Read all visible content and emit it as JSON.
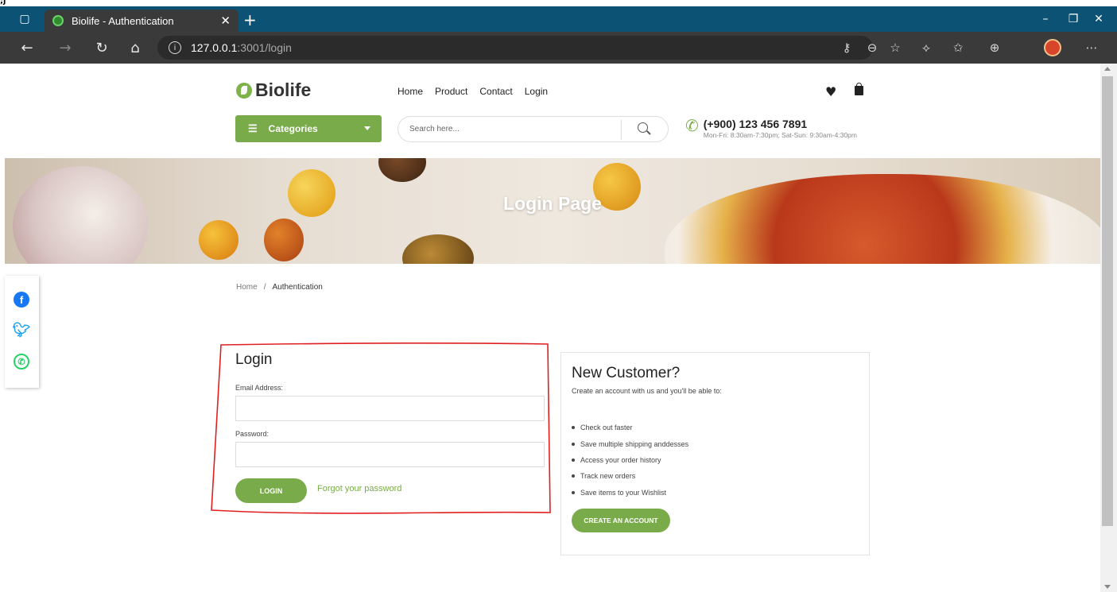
{
  "browser": {
    "tab_title": "Biolife - Authentication",
    "url_host": "127.0.0.1",
    "url_path": ":3001/login"
  },
  "site": {
    "logo": "Biolife",
    "nav": [
      "Home",
      "Product",
      "Contact",
      "Login"
    ],
    "categories_label": "Categories",
    "search_placeholder": "Search here...",
    "phone": "(+900) 123 456 7891",
    "hours": "Mon-Fri: 8:30am-7:30pm; Sat-Sun: 9:30am-4:30pm"
  },
  "banner": {
    "title": "Login Page"
  },
  "breadcrumb": {
    "home": "Home",
    "separator": "/",
    "current": "Authentication"
  },
  "login": {
    "title": "Login",
    "email_label": "Email Address:",
    "password_label": "Password:",
    "button": "LOGIN",
    "forgot": "Forgot your password"
  },
  "new_customer": {
    "title": "New Customer?",
    "subtitle": "Create an account with us and you'll be able to:",
    "benefits": [
      "Check out faster",
      "Save multiple shipping anddesses",
      "Access your order history",
      "Track new orders",
      "Save items to your Wishlist"
    ],
    "button": "CREATE AN ACCOUNT"
  },
  "colors": {
    "brand_green": "#7aab4a",
    "titlebar": "#0b5274",
    "annotation_red": "#e02020"
  }
}
